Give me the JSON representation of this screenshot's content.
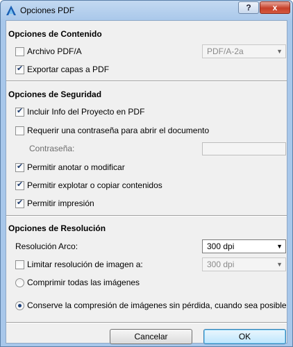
{
  "window": {
    "title": "Opciones PDF",
    "help_label": "?",
    "close_label": "x"
  },
  "content_section": {
    "title": "Opciones de Contenido",
    "pdfa": {
      "label": "Archivo PDF/A",
      "checked": false
    },
    "pdfa_select": {
      "value": "PDF/A-2a"
    },
    "export_layers": {
      "label": "Exportar capas a PDF",
      "checked": true
    }
  },
  "security_section": {
    "title": "Opciones de Seguridad",
    "include_info": {
      "label": "Incluir Info del Proyecto en PDF",
      "checked": true
    },
    "require_password": {
      "label": "Requerir una contraseña para abrir el documento",
      "checked": false
    },
    "password_label": "Contraseña:",
    "allow_annotate": {
      "label": "Permitir anotar o modificar",
      "checked": true
    },
    "allow_copy": {
      "label": "Permitir explotar o copiar contenidos",
      "checked": true
    },
    "allow_print": {
      "label": "Permitir impresión",
      "checked": true
    }
  },
  "resolution_section": {
    "title": "Opciones de Resolución",
    "arc_label": "Resolución Arco:",
    "arc_value": "300 dpi",
    "limit_image": {
      "label": "Limitar resolución de imagen a:",
      "checked": false
    },
    "limit_value": "300 dpi",
    "compress_all": {
      "label": "Comprimir todas las imágenes",
      "selected": false
    },
    "lossless": {
      "label": "Conserve la compresión de imágenes sin pérdida, cuando sea posible",
      "selected": true
    }
  },
  "buttons": {
    "cancel": "Cancelar",
    "ok": "OK"
  },
  "icons": {
    "app": "archicad-logo-icon",
    "dropdown": "chevron-down-icon"
  }
}
